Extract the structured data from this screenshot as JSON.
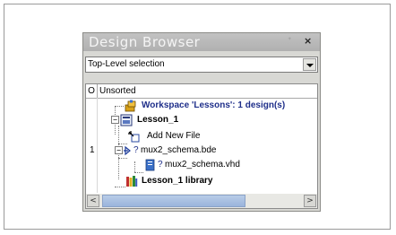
{
  "window": {
    "title": "Design Browser",
    "pin_glyph": "ᐩ",
    "close_glyph": "×"
  },
  "dropdown": {
    "value": "Top-Level selection"
  },
  "columns": {
    "o": "O",
    "main": "Unsorted"
  },
  "tree": {
    "workspace": "Workspace 'Lessons': 1 design(s)",
    "design": "Lesson_1",
    "add_new_file": "Add New File",
    "row_number": "1",
    "schema_bde": "mux2_schema.bde",
    "schema_vhd": "mux2_schema.vhd",
    "library": "Lesson_1 library",
    "unknown_status": "?"
  },
  "icons": {
    "workspace": "workspace-icon",
    "design": "design-icon",
    "add_file": "add-file-icon",
    "bde": "schematic-file-icon",
    "vhd": "vhdl-file-icon",
    "library": "library-icon"
  },
  "scroll": {
    "left_glyph": "<",
    "right_glyph": ">"
  }
}
